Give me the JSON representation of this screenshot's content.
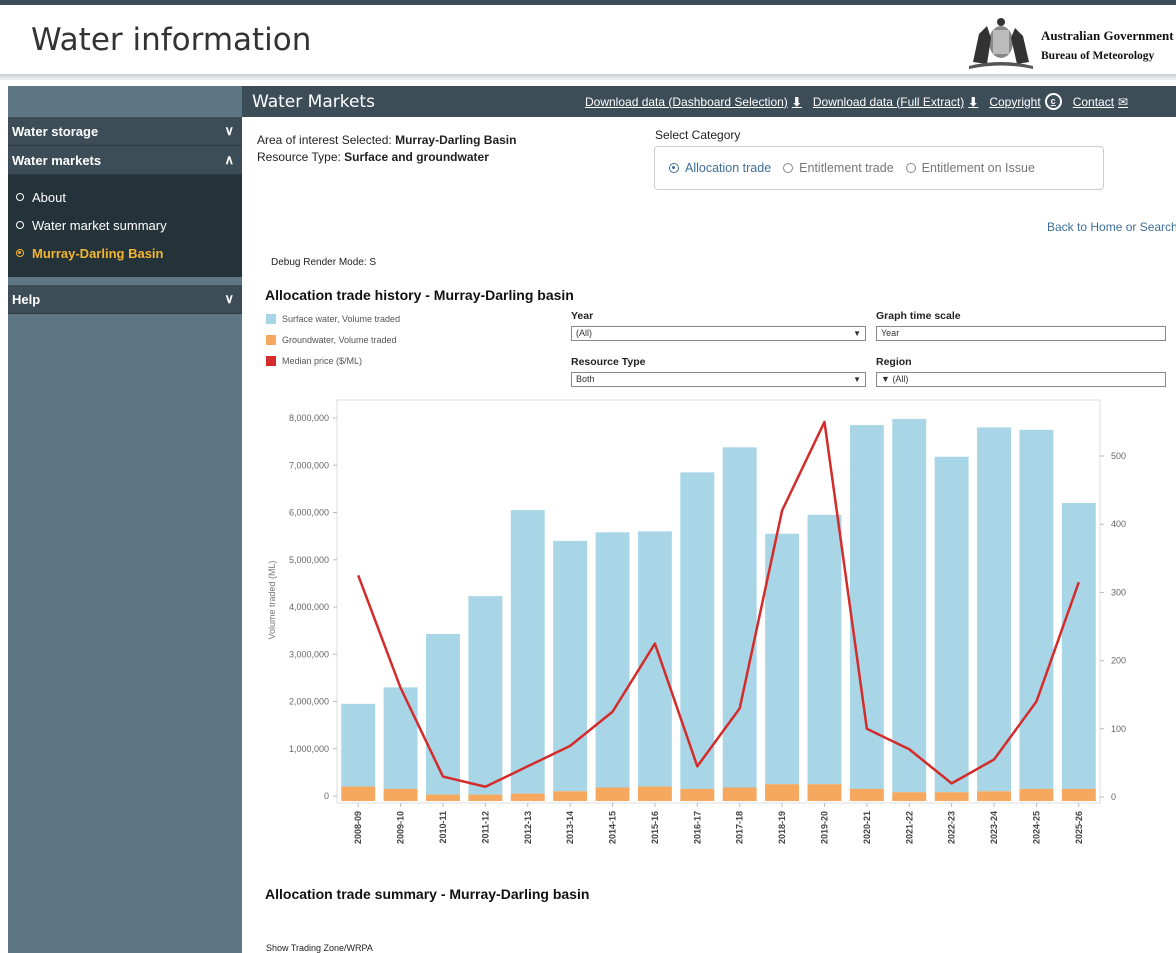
{
  "header": {
    "site_title": "Water information",
    "gov_line1": "Australian Government",
    "gov_line2": "Bureau of Meteorology"
  },
  "sidebar": {
    "items": [
      {
        "label": "Water storage",
        "expanded": false
      },
      {
        "label": "Water markets",
        "expanded": true
      },
      {
        "label": "Help",
        "expanded": false
      }
    ],
    "sub_items": [
      {
        "label": "About",
        "active": false
      },
      {
        "label": "Water market summary",
        "active": false
      },
      {
        "label": "Murray-Darling Basin",
        "active": true
      }
    ]
  },
  "titlebar": {
    "title": "Water Markets",
    "links": {
      "download_selection": "Download data (Dashboard Selection)",
      "download_full": "Download data (Full Extract)",
      "copyright": "Copyright",
      "contact": "Contact"
    }
  },
  "info": {
    "aoi_label": "Area of interest Selected:",
    "aoi_value": "Murray-Darling Basin",
    "rt_label": "Resource Type:",
    "rt_value": "Surface and groundwater"
  },
  "category": {
    "label": "Select Category",
    "options": [
      "Allocation trade",
      "Entitlement trade",
      "Entitlement on Issue"
    ],
    "selected": "Allocation trade"
  },
  "back_link": "Back to Home or Search",
  "debug": "Debug Render Mode: S",
  "filters": {
    "year_label": "Year",
    "year_value": "(All)",
    "scale_label": "Graph time scale",
    "scale_value": "Year",
    "resource_label": "Resource Type",
    "resource_value": "Both",
    "region_label": "Region",
    "region_value": "(All)"
  },
  "summary_title": "Allocation trade summary - Murray-Darling basin",
  "trading_zone_label": "Show Trading Zone/WRPA",
  "colors": {
    "surface": "#a8d6e6",
    "ground": "#f5a85e",
    "price": "#d42b2b",
    "sidebar": "#5f7785",
    "dark": "#3c4d57",
    "active": "#f4b531"
  },
  "chart_data": {
    "type": "bar",
    "title": "Allocation trade history - Murray-Darling basin",
    "ylabel": "Volume traded (ML)",
    "ylim": [
      0,
      8000000
    ],
    "y_ticks": [
      "0",
      "1,000,000",
      "2,000,000",
      "3,000,000",
      "4,000,000",
      "5,000,000",
      "6,000,000",
      "7,000,000",
      "8,000,000"
    ],
    "y2lim": [
      0,
      550
    ],
    "y2_ticks": [
      "0",
      "100",
      "200",
      "300",
      "400",
      "500"
    ],
    "categories": [
      "2008-09",
      "2009-10",
      "2010-11",
      "2011-12",
      "2012-13",
      "2013-14",
      "2014-15",
      "2015-16",
      "2016-17",
      "2017-18",
      "2018-19",
      "2019-20",
      "2020-21",
      "2021-22",
      "2022-23",
      "2023-24",
      "2024-25",
      "2025-26"
    ],
    "series": [
      {
        "name": "Surface water, Volume traded",
        "values": [
          1750000,
          2150000,
          3400000,
          4200000,
          6000000,
          5300000,
          5400000,
          5400000,
          6700000,
          7200000,
          5300000,
          5700000,
          7700000,
          7900000,
          7100000,
          7700000,
          7600000,
          6050000
        ]
      },
      {
        "name": "Groundwater, Volume traded",
        "values": [
          200000,
          150000,
          30000,
          30000,
          50000,
          100000,
          180000,
          200000,
          150000,
          180000,
          250000,
          250000,
          150000,
          80000,
          80000,
          100000,
          150000,
          150000
        ]
      },
      {
        "name": "Median price ($/ML)",
        "axis": "right",
        "values": [
          325,
          160,
          30,
          15,
          45,
          75,
          125,
          225,
          45,
          130,
          420,
          550,
          100,
          70,
          20,
          55,
          140,
          315
        ]
      }
    ],
    "legend_position": "top-left"
  }
}
